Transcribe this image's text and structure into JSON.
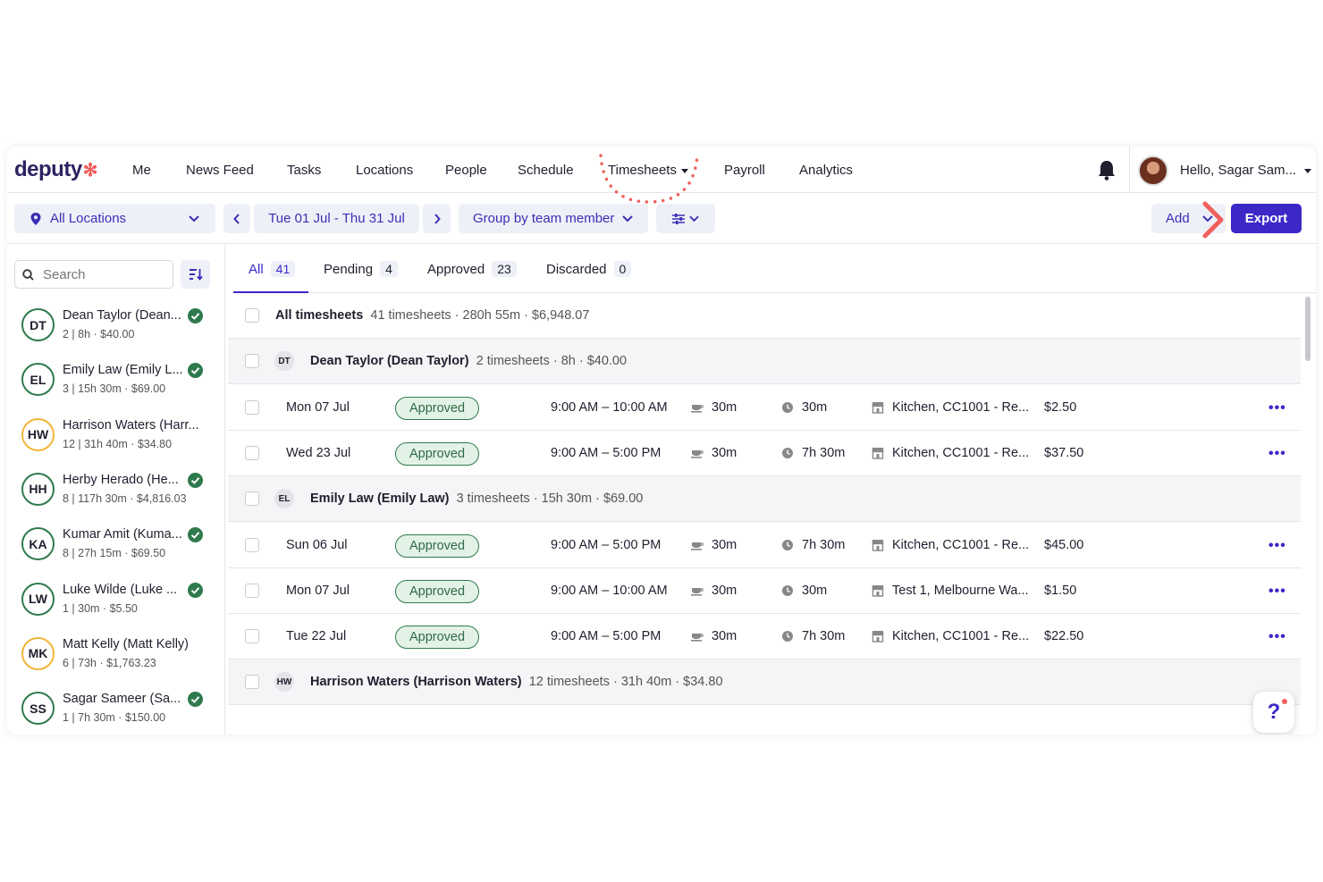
{
  "nav": {
    "logo": "deputy",
    "items": [
      "Me",
      "News Feed",
      "Tasks",
      "Locations",
      "People",
      "Schedule",
      "Timesheets",
      "Payroll",
      "Analytics"
    ],
    "user_greeting": "Hello, Sagar Sam..."
  },
  "toolbar": {
    "location": "All Locations",
    "date_range": "Tue 01 Jul - Thu 31 Jul",
    "group_by": "Group by team member",
    "add_label": "Add",
    "export_label": "Export"
  },
  "sidebar": {
    "search_placeholder": "Search",
    "people": [
      {
        "initials": "DT",
        "name": "Dean Taylor (Dean...",
        "sub": "2 | 8h · $40.00",
        "status": "approved"
      },
      {
        "initials": "EL",
        "name": "Emily Law (Emily L...",
        "sub": "3 | 15h 30m · $69.00",
        "status": "approved"
      },
      {
        "initials": "HW",
        "name": "Harrison Waters (Harr...",
        "sub": "12 | 31h 40m · $34.80",
        "status": "pending"
      },
      {
        "initials": "HH",
        "name": "Herby Herado (He...",
        "sub": "8 | 117h 30m · $4,816.03",
        "status": "approved"
      },
      {
        "initials": "KA",
        "name": "Kumar Amit (Kuma...",
        "sub": "8 | 27h 15m · $69.50",
        "status": "approved"
      },
      {
        "initials": "LW",
        "name": "Luke Wilde (Luke ...",
        "sub": "1 | 30m · $5.50",
        "status": "approved"
      },
      {
        "initials": "MK",
        "name": "Matt Kelly (Matt Kelly)",
        "sub": "6 | 73h · $1,763.23",
        "status": "pending"
      },
      {
        "initials": "SS",
        "name": "Sagar Sameer (Sa...",
        "sub": "1 | 7h 30m · $150.00",
        "status": "approved"
      }
    ]
  },
  "tabs": [
    {
      "label": "All",
      "count": "41"
    },
    {
      "label": "Pending",
      "count": "4"
    },
    {
      "label": "Approved",
      "count": "23"
    },
    {
      "label": "Discarded",
      "count": "0"
    }
  ],
  "all_row": {
    "label": "All timesheets",
    "summary": "41 timesheets · 280h 55m · $6,948.07"
  },
  "groups": [
    {
      "initials": "DT",
      "name": "Dean Taylor (Dean Taylor)",
      "summary": "2 timesheets · 8h · $40.00"
    },
    {
      "initials": "EL",
      "name": "Emily Law (Emily Law)",
      "summary": "3 timesheets · 15h 30m · $69.00"
    },
    {
      "initials": "HW",
      "name": "Harrison Waters (Harrison Waters)",
      "summary": "12 timesheets · 31h 40m · $34.80"
    }
  ],
  "entries": [
    {
      "date": "Mon 07 Jul",
      "status": "Approved",
      "time": "9:00 AM – 10:00 AM",
      "break": "30m",
      "duration": "30m",
      "location": "Kitchen, CC1001 - Re...",
      "cost": "$2.50"
    },
    {
      "date": "Wed 23 Jul",
      "status": "Approved",
      "time": "9:00 AM – 5:00 PM",
      "break": "30m",
      "duration": "7h 30m",
      "location": "Kitchen, CC1001 - Re...",
      "cost": "$37.50"
    },
    {
      "date": "Sun 06 Jul",
      "status": "Approved",
      "time": "9:00 AM – 5:00 PM",
      "break": "30m",
      "duration": "7h 30m",
      "location": "Kitchen, CC1001 - Re...",
      "cost": "$45.00"
    },
    {
      "date": "Mon 07 Jul",
      "status": "Approved",
      "time": "9:00 AM – 10:00 AM",
      "break": "30m",
      "duration": "30m",
      "location": "Test 1, Melbourne Wa...",
      "cost": "$1.50"
    },
    {
      "date": "Tue 22 Jul",
      "status": "Approved",
      "time": "9:00 AM – 5:00 PM",
      "break": "30m",
      "duration": "7h 30m",
      "location": "Kitchen, CC1001 - Re...",
      "cost": "$22.50"
    }
  ],
  "help_label": "?",
  "colors": {
    "brand": "#3b28c7",
    "approved": "#2f7a4d",
    "accent": "#f0605d"
  }
}
